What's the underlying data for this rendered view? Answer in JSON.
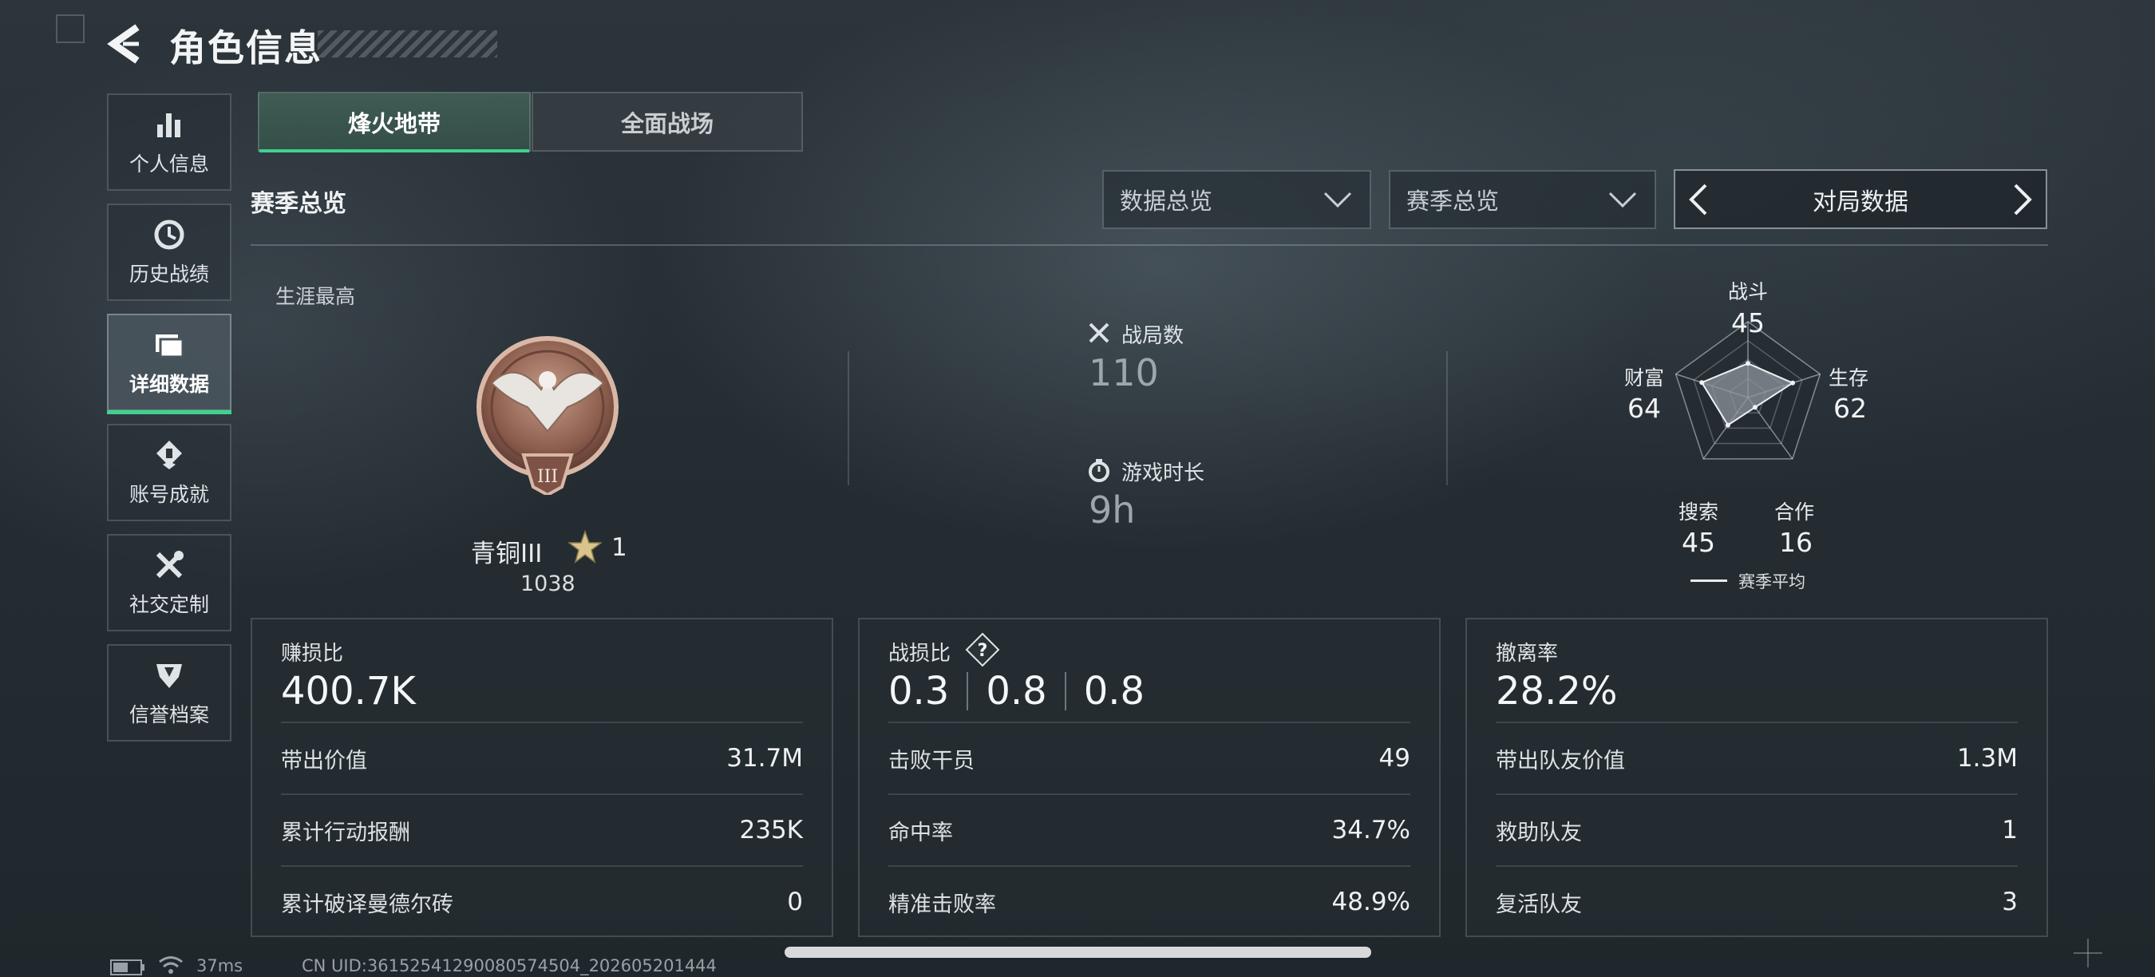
{
  "header": {
    "title": "角色信息"
  },
  "sidebar": {
    "items": [
      {
        "label": "个人信息",
        "icon": "bar-chart-icon"
      },
      {
        "label": "历史战绩",
        "icon": "history-clock-icon"
      },
      {
        "label": "详细数据",
        "icon": "folder-icon",
        "active": true
      },
      {
        "label": "账号成就",
        "icon": "achievement-icon"
      },
      {
        "label": "社交定制",
        "icon": "tools-icon"
      },
      {
        "label": "信誉档案",
        "icon": "shield-badge-icon"
      }
    ]
  },
  "mode_tabs": [
    {
      "label": "烽火地带",
      "active": true
    },
    {
      "label": "全面战场",
      "active": false
    }
  ],
  "section": {
    "title": "赛季总览",
    "dropdown_data": "数据总览",
    "dropdown_season": "赛季总览",
    "switcher_label": "对局数据"
  },
  "career": {
    "label": "生涯最高",
    "rank_name": "青铜III",
    "stars": "1",
    "score": "1038"
  },
  "overview": {
    "matches_label": "战局数",
    "matches_value": "110",
    "playtime_label": "游戏时长",
    "playtime_value": "9h"
  },
  "radar": {
    "combat_label": "战斗",
    "combat_value": "45",
    "survival_label": "生存",
    "survival_value": "62",
    "cooperation_label": "合作",
    "cooperation_value": "16",
    "search_label": "搜索",
    "search_value": "45",
    "wealth_label": "财富",
    "wealth_value": "64",
    "legend": "赛季平均"
  },
  "chart_data": {
    "type": "radar",
    "categories": [
      "战斗",
      "生存",
      "合作",
      "搜索",
      "财富"
    ],
    "values": [
      45,
      62,
      16,
      45,
      64
    ],
    "range": [
      0,
      100
    ]
  },
  "cards": {
    "profit": {
      "label": "赚损比",
      "value": "400.7K",
      "rows": [
        {
          "key": "带出价值",
          "value": "31.7M"
        },
        {
          "key": "累计行动报酬",
          "value": "235K"
        },
        {
          "key": "累计破译曼德尔砖",
          "value": "0"
        }
      ]
    },
    "combat": {
      "label": "战损比",
      "values": [
        "0.3",
        "0.8",
        "0.8"
      ],
      "rows": [
        {
          "key": "击败干员",
          "value": "49"
        },
        {
          "key": "命中率",
          "value": "34.7%"
        },
        {
          "key": "精准击败率",
          "value": "48.9%"
        }
      ]
    },
    "extract": {
      "label": "撤离率",
      "value": "28.2%",
      "rows": [
        {
          "key": "带出队友价值",
          "value": "1.3M"
        },
        {
          "key": "救助队友",
          "value": "1"
        },
        {
          "key": "复活队友",
          "value": "3"
        }
      ]
    }
  },
  "status": {
    "ping": "37ms",
    "uid": "CN UID:3615254129008057450​4_202605201444"
  },
  "colors": {
    "accent": "#3fd28f",
    "background": "#252d33",
    "text": "#e6eaec"
  }
}
